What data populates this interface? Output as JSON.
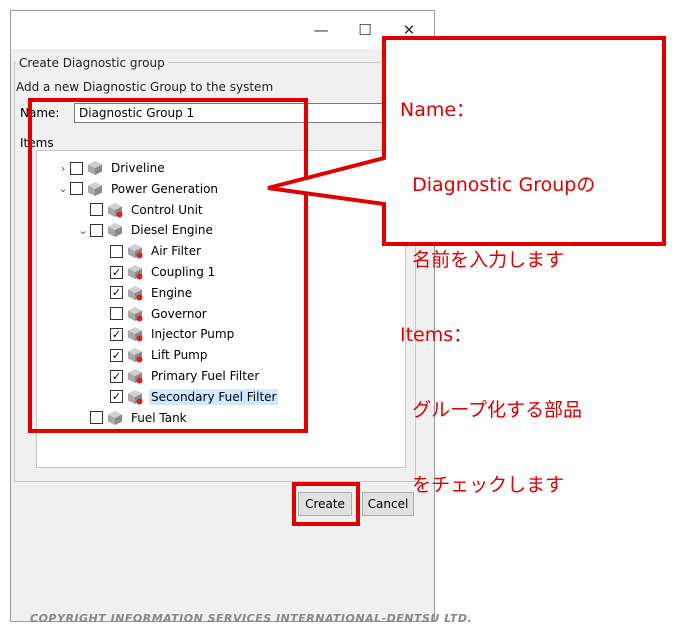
{
  "window": {
    "minimize_glyph": "—",
    "maximize_glyph": "☐",
    "close_glyph": "✕"
  },
  "dialog": {
    "group_title": "Create Diagnostic group",
    "subtitle": "Add a new Diagnostic Group to the system",
    "name_label": "Name:",
    "name_value": "Diagnostic Group 1",
    "items_label": "Items",
    "create_label": "Create",
    "cancel_label": "Cancel"
  },
  "tree": [
    {
      "label": "Driveline",
      "indent": 0,
      "expander": "›",
      "checked": false,
      "icon": "cube-icon",
      "selected": false
    },
    {
      "label": "Power Generation",
      "indent": 0,
      "expander": "⌄",
      "checked": false,
      "icon": "cube-icon",
      "selected": false
    },
    {
      "label": "Control Unit",
      "indent": 1,
      "expander": "",
      "checked": false,
      "icon": "cube-alert-icon",
      "selected": false
    },
    {
      "label": "Diesel Engine",
      "indent": 1,
      "expander": "⌄",
      "checked": false,
      "icon": "cube-icon",
      "selected": false
    },
    {
      "label": "Air Filter",
      "indent": 2,
      "expander": "",
      "checked": false,
      "icon": "cube-alert-icon",
      "selected": false
    },
    {
      "label": "Coupling 1",
      "indent": 2,
      "expander": "",
      "checked": true,
      "icon": "cube-alert-icon",
      "selected": false
    },
    {
      "label": "Engine",
      "indent": 2,
      "expander": "",
      "checked": true,
      "icon": "cube-alert-icon",
      "selected": false
    },
    {
      "label": "Governor",
      "indent": 2,
      "expander": "",
      "checked": false,
      "icon": "cube-alert-icon",
      "selected": false
    },
    {
      "label": "Injector Pump",
      "indent": 2,
      "expander": "",
      "checked": true,
      "icon": "cube-alert-icon",
      "selected": false
    },
    {
      "label": "Lift Pump",
      "indent": 2,
      "expander": "",
      "checked": true,
      "icon": "cube-alert-icon",
      "selected": false
    },
    {
      "label": "Primary Fuel Filter",
      "indent": 2,
      "expander": "",
      "checked": true,
      "icon": "cube-alert-icon",
      "selected": false
    },
    {
      "label": "Secondary Fuel Filter",
      "indent": 2,
      "expander": "",
      "checked": true,
      "icon": "cube-alert-icon",
      "selected": true
    },
    {
      "label": "Fuel Tank",
      "indent": 1,
      "expander": "",
      "checked": false,
      "icon": "cube-icon",
      "selected": false
    }
  ],
  "callout": {
    "lines": [
      "Name：",
      "  Diagnostic Groupの",
      "  名前を入力します",
      "Items：",
      "  グループ化する部品",
      "  をチェックします"
    ],
    "color": "#e00000"
  },
  "footer": {
    "copyright": "COPYRIGHT INFORMATION SERVICES INTERNATIONAL-DENTSU LTD."
  }
}
